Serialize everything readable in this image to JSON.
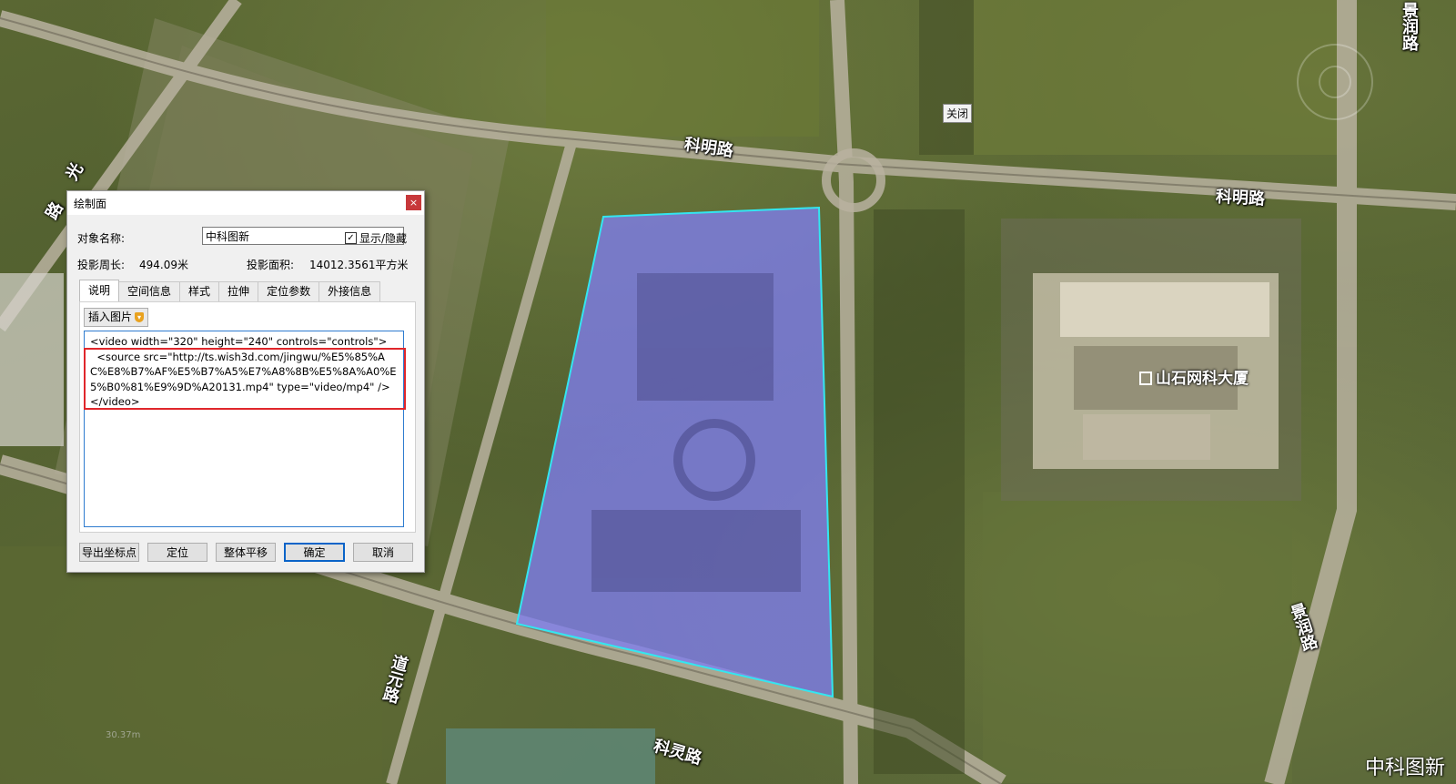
{
  "map": {
    "roads": {
      "keming_top": "科明路",
      "keming_right": "科明路",
      "guang_left": "光",
      "lu_left": "路",
      "jingrun_top": "景润路",
      "jingrun_bottom": "景润路",
      "daoyuan": "道元路",
      "keling": "科灵路"
    },
    "close_tag": "关闭",
    "poi_name": "山石网科大厦",
    "scale_text": "30.37m",
    "watermark": "中科图新",
    "polygon_fill": "#7f7df0",
    "polygon_stroke": "#33e6f0"
  },
  "dialog": {
    "title": "绘制面",
    "close_glyph": "×",
    "name_label": "对象名称:",
    "name_value": "中科图新",
    "show_hide_label": "显示/隐藏",
    "show_hide_checked": "✓",
    "perimeter_label": "投影周长:",
    "perimeter_value": "494.09米",
    "area_label": "投影面积:",
    "area_value": "14012.3561平方米",
    "tabs": [
      {
        "label": "说明"
      },
      {
        "label": "空间信息"
      },
      {
        "label": "样式"
      },
      {
        "label": "拉伸"
      },
      {
        "label": "定位参数"
      },
      {
        "label": "外接信息"
      }
    ],
    "insert_image_label": "插入图片",
    "editor_text": "<video width=\"320\" height=\"240\" controls=\"controls\">\n  <source src=\"http://ts.wish3d.com/jingwu/%E5%85%AC%E8%B7%AF%E5%B7%A5%E7%A8%8B%E5%8A%A0%E5%B0%81%E9%9D%A20131.mp4\" type=\"video/mp4\" />\n</video>",
    "buttons": {
      "export": "导出坐标点",
      "locate": "定位",
      "translate": "整体平移",
      "ok": "确定",
      "cancel": "取消"
    },
    "highlight_color": "#e0262b",
    "accent": "#0a64c8"
  }
}
